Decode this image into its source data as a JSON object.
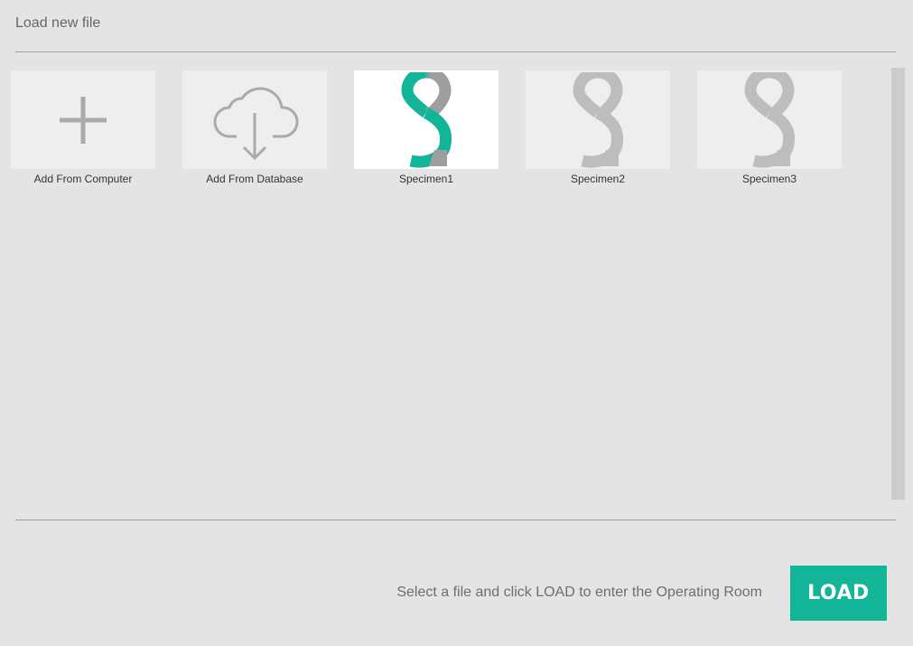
{
  "header": {
    "title": "Load new file"
  },
  "tiles": [
    {
      "label": "Add From Computer",
      "icon": "plus-icon"
    },
    {
      "label": "Add From Database",
      "icon": "cloud-download-icon"
    },
    {
      "label": "Specimen1",
      "icon": "specimen-logo-icon",
      "selected": true
    },
    {
      "label": "Specimen2",
      "icon": "specimen-logo-icon",
      "selected": false
    },
    {
      "label": "Specimen3",
      "icon": "specimen-logo-icon",
      "selected": false
    }
  ],
  "footer": {
    "status_text": "Select a file and click LOAD to enter the Operating Room",
    "load_label": "LOAD"
  },
  "colors": {
    "accent": "#12b597",
    "icon_gray": "#aaaaaa",
    "logo_inactive": "#bdbdbd",
    "logo_selected_loop": "#9e9e9e"
  }
}
